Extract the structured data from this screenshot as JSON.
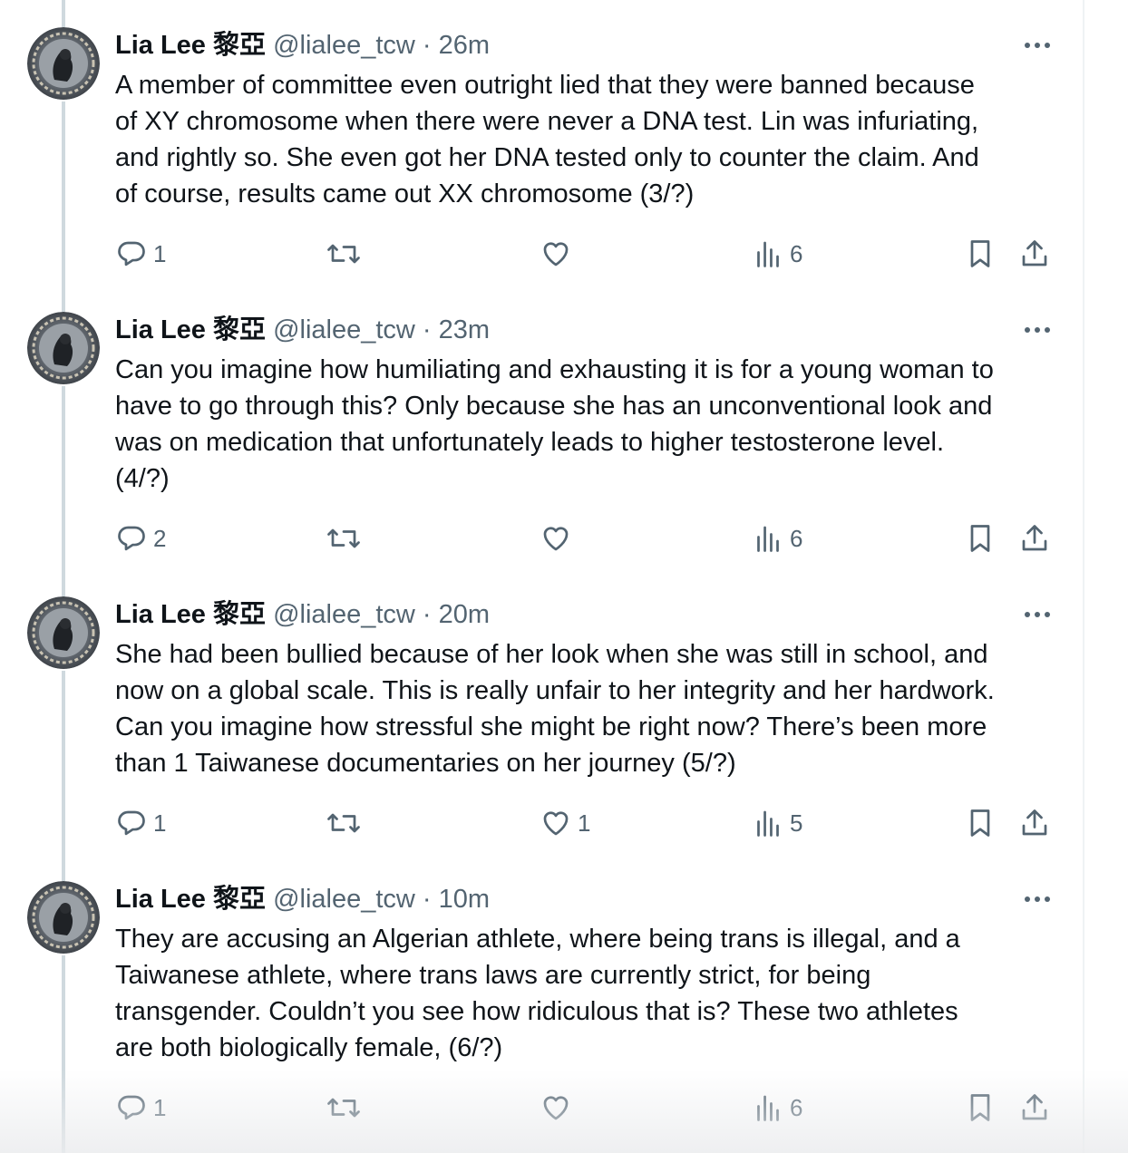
{
  "tweets": [
    {
      "name": "Lia Lee 黎亞",
      "handle": "@lialee_tcw",
      "separator": "·",
      "time": "26m",
      "text": "A member of committee even outright lied that they were banned because\nof XY chromosome when there were never a DNA test. Lin was infuriating,\nand rightly so. She even got her DNA tested only to counter the claim. And\nof course, results came out XX chromosome (3/?)",
      "replies": "1",
      "reposts": "",
      "likes": "",
      "views": "6"
    },
    {
      "name": "Lia Lee 黎亞",
      "handle": "@lialee_tcw",
      "separator": "·",
      "time": "23m",
      "text": "Can you imagine how humiliating and exhausting it is for a young woman to\nhave to go through this? Only because she has an unconventional look and\nwas on medication that unfortunately leads to higher testosterone level.\n(4/?)",
      "replies": "2",
      "reposts": "",
      "likes": "",
      "views": "6"
    },
    {
      "name": "Lia Lee 黎亞",
      "handle": "@lialee_tcw",
      "separator": "·",
      "time": "20m",
      "text": "She had been bullied because of her look when she was still in school, and\nnow on a global scale. This is really unfair to her integrity and her hardwork.\nCan you imagine how stressful she might be right now? There’s been more\nthan 1 Taiwanese documentaries on her journey (5/?)",
      "replies": "1",
      "reposts": "",
      "likes": "1",
      "views": "5"
    },
    {
      "name": "Lia Lee 黎亞",
      "handle": "@lialee_tcw",
      "separator": "·",
      "time": "10m",
      "text": "They are accusing an Algerian athlete, where being trans is illegal, and a\nTaiwanese athlete, where trans laws are currently strict, for being\ntransgender. Couldn’t you see how ridiculous that is? These two athletes\nare both biologically female, (6/?)",
      "replies": "1",
      "reposts": "",
      "likes": "",
      "views": "6"
    }
  ],
  "icons": {
    "reply": "reply-icon",
    "repost": "repost-icon",
    "like": "heart-icon",
    "views": "views-chart-icon",
    "bookmark": "bookmark-icon",
    "share": "share-icon",
    "more": "more-dots-icon"
  },
  "colors": {
    "text": "#0f1419",
    "secondary": "#536471",
    "thread_line": "#cfd9de"
  }
}
